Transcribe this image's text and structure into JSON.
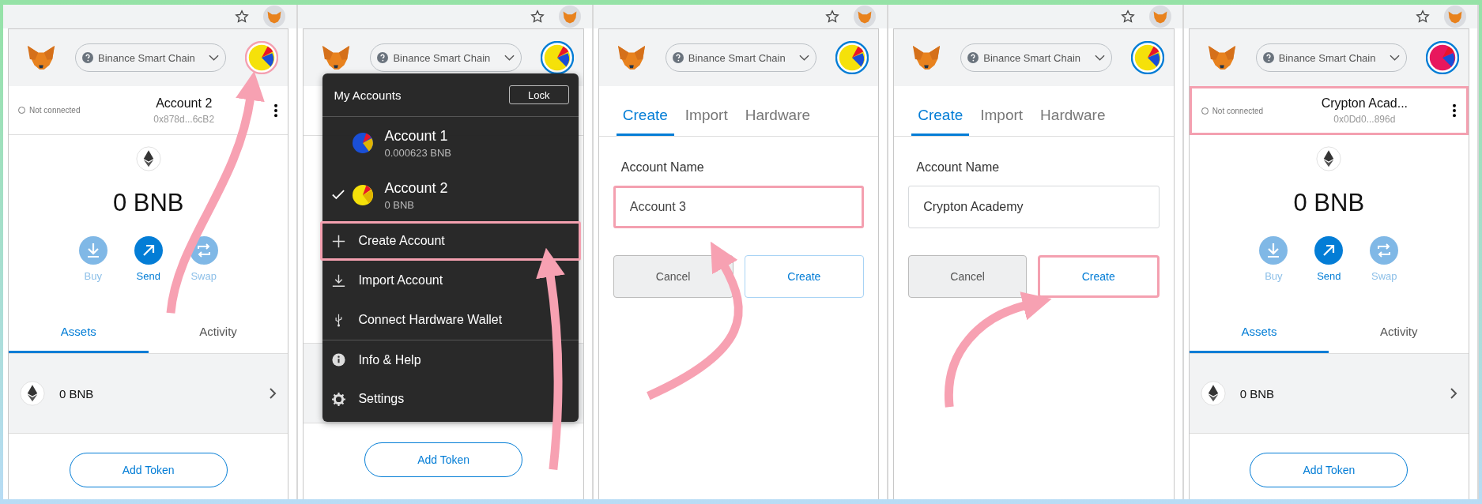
{
  "panels": [
    {
      "kind": "wallet",
      "arrow": true,
      "network": "Binance Smart Chain",
      "avatar": {
        "color": "#f5e10a",
        "highlighted": true
      },
      "account_bar": {
        "connection": "Not connected",
        "name": "Account 2",
        "address": "0x878d...6cB2",
        "highlighted": false
      },
      "balance": "0 BNB",
      "actions": [
        {
          "kind": "buy",
          "label": "Buy",
          "disabled": true
        },
        {
          "kind": "send",
          "label": "Send",
          "disabled": false
        },
        {
          "kind": "swap",
          "label": "Swap",
          "disabled": true
        }
      ],
      "tabs": [
        {
          "label": "Assets",
          "selected": true
        },
        {
          "label": "Activity",
          "selected": false
        }
      ],
      "assets": [
        {
          "amount": "0 BNB"
        }
      ],
      "add_token": "Add Token"
    },
    {
      "kind": "menu",
      "arrow": true,
      "network": "Binance Smart Chain",
      "avatar": {
        "color": "#f5e10a",
        "highlighted": false
      },
      "add_token": "Add Token",
      "menu": {
        "title": "My Accounts",
        "lock": "Lock",
        "accounts": [
          {
            "name": "Account 1",
            "balance": "0.000623 BNB",
            "selected": false,
            "color": "#1a4fd6"
          },
          {
            "name": "Account 2",
            "balance": "0 BNB",
            "selected": true,
            "color": "#f5e10a"
          }
        ],
        "items": [
          {
            "kind": "create",
            "label": "Create Account",
            "highlighted": true
          },
          {
            "kind": "import",
            "label": "Import Account",
            "highlighted": false
          },
          {
            "kind": "hardware",
            "label": "Connect Hardware Wallet",
            "highlighted": false
          },
          {
            "kind": "info",
            "label": "Info & Help",
            "highlighted": false
          },
          {
            "kind": "settings",
            "label": "Settings",
            "highlighted": false
          }
        ]
      }
    },
    {
      "kind": "create",
      "arrow": true,
      "network": "Binance Smart Chain",
      "avatar": {
        "color": "#f5e10a",
        "highlighted": false
      },
      "tabs": [
        {
          "label": "Create",
          "selected": true
        },
        {
          "label": "Import",
          "selected": false
        },
        {
          "label": "Hardware",
          "selected": false
        }
      ],
      "field": {
        "label": "Account Name",
        "placeholder": "Account 3",
        "highlighted": true
      },
      "cancel": "Cancel",
      "create": {
        "label": "Create",
        "highlighted": false
      }
    },
    {
      "kind": "create",
      "arrow": true,
      "network": "Binance Smart Chain",
      "avatar": {
        "color": "#f5e10a",
        "highlighted": false
      },
      "tabs": [
        {
          "label": "Create",
          "selected": true
        },
        {
          "label": "Import",
          "selected": false
        },
        {
          "label": "Hardware",
          "selected": false
        }
      ],
      "field": {
        "label": "Account Name",
        "value": "Crypton Academy",
        "highlighted": false
      },
      "cancel": "Cancel",
      "create": {
        "label": "Create",
        "highlighted": true
      }
    },
    {
      "kind": "wallet",
      "arrow": false,
      "network": "Binance Smart Chain",
      "avatar": {
        "color": "#e8175d",
        "highlighted": false
      },
      "account_bar": {
        "connection": "Not connected",
        "name": "Crypton Acad...",
        "address": "0x0Dd0...896d",
        "highlighted": true
      },
      "balance": "0 BNB",
      "actions": [
        {
          "kind": "buy",
          "label": "Buy",
          "disabled": true
        },
        {
          "kind": "send",
          "label": "Send",
          "disabled": false
        },
        {
          "kind": "swap",
          "label": "Swap",
          "disabled": true
        }
      ],
      "tabs": [
        {
          "label": "Assets",
          "selected": true
        },
        {
          "label": "Activity",
          "selected": false
        }
      ],
      "assets": [
        {
          "amount": "0 BNB"
        }
      ],
      "add_token": "Add Token"
    }
  ]
}
